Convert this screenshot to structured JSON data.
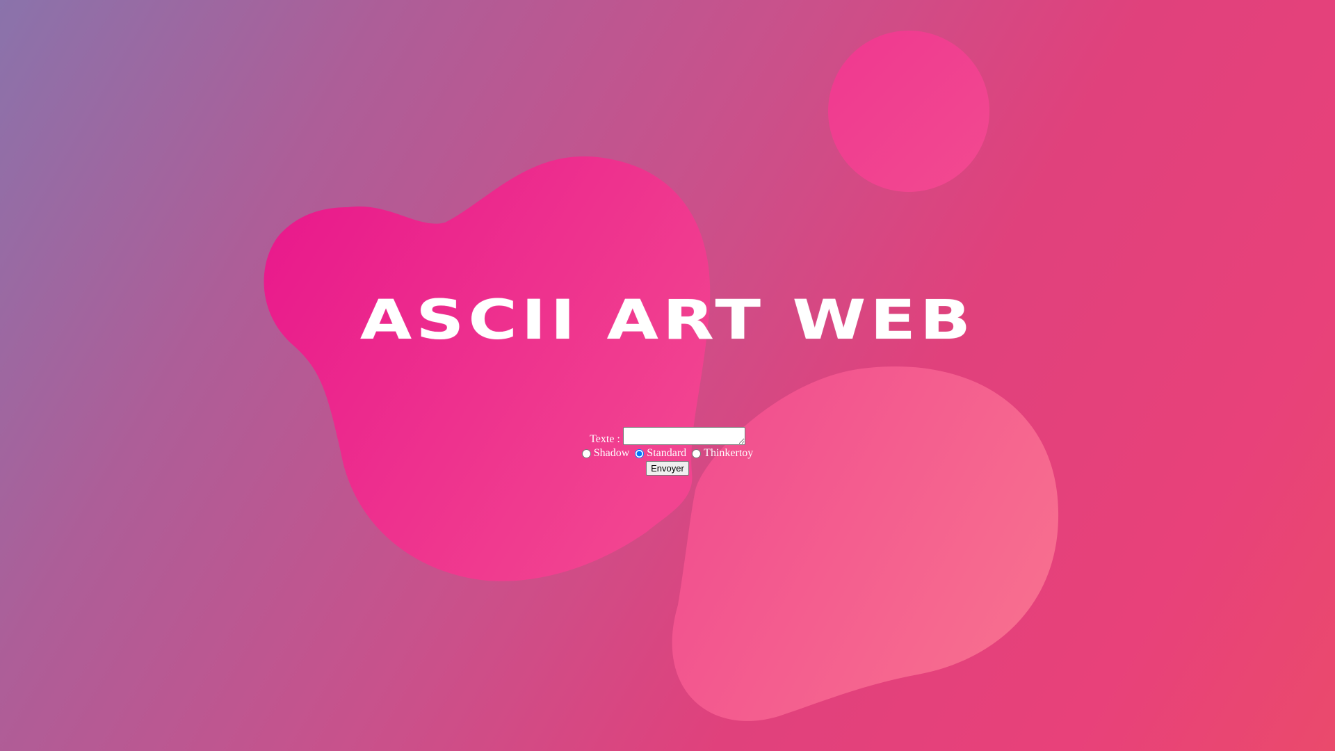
{
  "page": {
    "title": "ASCII ART WEB"
  },
  "form": {
    "text_label": "Texte :",
    "text_value": "",
    "banner_options": [
      {
        "label": "Shadow",
        "checked": false
      },
      {
        "label": "Standard",
        "checked": true
      },
      {
        "label": "Thinkertoy",
        "checked": false
      }
    ],
    "submit_label": "Envoyer"
  },
  "colors": {
    "gradient_start": "#8a73ab",
    "gradient_mid": "#c9518b",
    "gradient_end": "#ea4a6c",
    "blob_primary": "#e91e8c",
    "blob_light": "#f56a8e",
    "circle": "#f03d8e",
    "title_text": "#ffffff"
  }
}
